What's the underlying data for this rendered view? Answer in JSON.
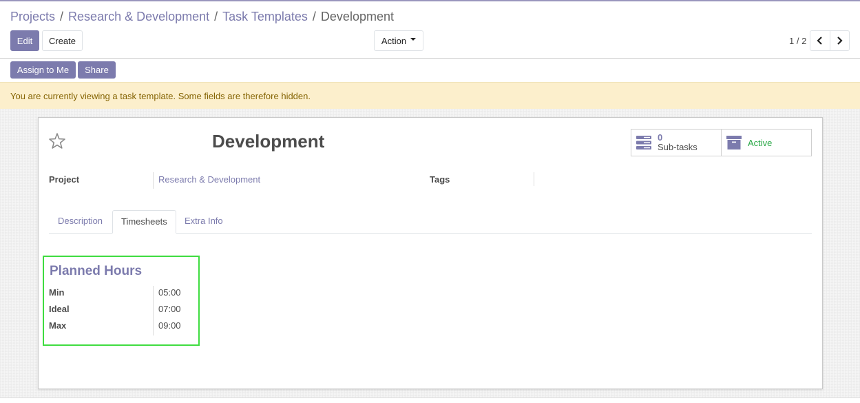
{
  "breadcrumb": {
    "items": [
      "Projects",
      "Research & Development",
      "Task Templates"
    ],
    "separator": "/",
    "current": "Development"
  },
  "control_panel": {
    "edit_label": "Edit",
    "create_label": "Create",
    "action_label": "Action",
    "pager_value": "1 / 2",
    "prev_icon": "chevron-left-icon",
    "next_icon": "chevron-right-icon"
  },
  "statusbar": {
    "assign_label": "Assign to Me",
    "share_label": "Share"
  },
  "alert": {
    "message": "You are currently viewing a task template. Some fields are therefore hidden."
  },
  "record": {
    "title": "Development",
    "favorite_icon": "star-outline-icon",
    "smart_buttons": {
      "subtasks_value": "0",
      "subtasks_label": "Sub-tasks",
      "active_label": "Active"
    },
    "fields": {
      "project_label": "Project",
      "project_value": "Research & Development",
      "tags_label": "Tags"
    },
    "tabs": [
      {
        "label": "Description",
        "active": false
      },
      {
        "label": "Timesheets",
        "active": true
      },
      {
        "label": "Extra Info",
        "active": false
      }
    ],
    "planned_hours": {
      "title": "Planned Hours",
      "rows": [
        {
          "label": "Min",
          "value": "05:00"
        },
        {
          "label": "Ideal",
          "value": "07:00"
        },
        {
          "label": "Max",
          "value": "09:00"
        }
      ]
    }
  },
  "colors": {
    "brand": "#7c7bad",
    "alert_bg": "#fcefcc",
    "alert_text": "#856404",
    "active_green": "#28a745",
    "highlight_border": "#3fdc40"
  }
}
